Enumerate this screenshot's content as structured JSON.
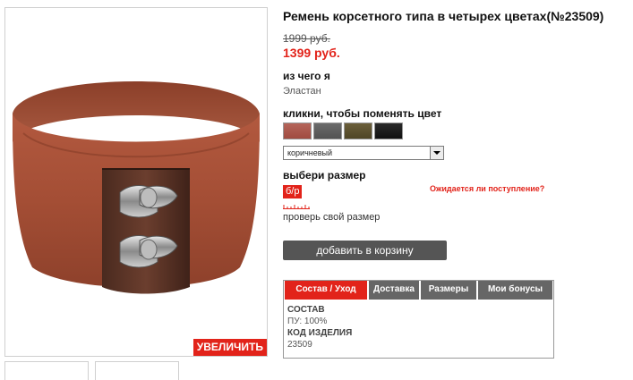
{
  "product": {
    "title": "Ремень корсетного типа в четырех цветах(№23509)",
    "old_price": "1999 руб.",
    "new_price": "1399 руб.",
    "zoom_label": "УВЕЛИЧИТЬ"
  },
  "material": {
    "label": "из чего я",
    "value": "Эластан"
  },
  "color": {
    "label": "кликни, чтобы поменять цвет",
    "swatches": [
      "#a9564b",
      "#5e5e5e",
      "#5c5131",
      "#1c1c1c"
    ],
    "selected": "коричневый"
  },
  "size": {
    "label": "выбери размер",
    "option": "б/р",
    "restock_link": "Ожидается ли поступление?",
    "check_size": "проверь свой размер"
  },
  "cart": {
    "add_label": "добавить в корзину"
  },
  "tabs": {
    "items": [
      "Состав / Уход",
      "Доставка",
      "Размеры",
      "Мои бонусы"
    ],
    "active": "Состав / Уход",
    "content": {
      "composition_heading": "СОСТАВ",
      "composition_value": "ПУ: 100%",
      "code_heading": "КОД ИЗДЕЛИЯ",
      "code_value": "23509"
    }
  },
  "colors": {
    "accent": "#e2231a",
    "dark_button": "#555555",
    "tab_inactive": "#666666"
  }
}
